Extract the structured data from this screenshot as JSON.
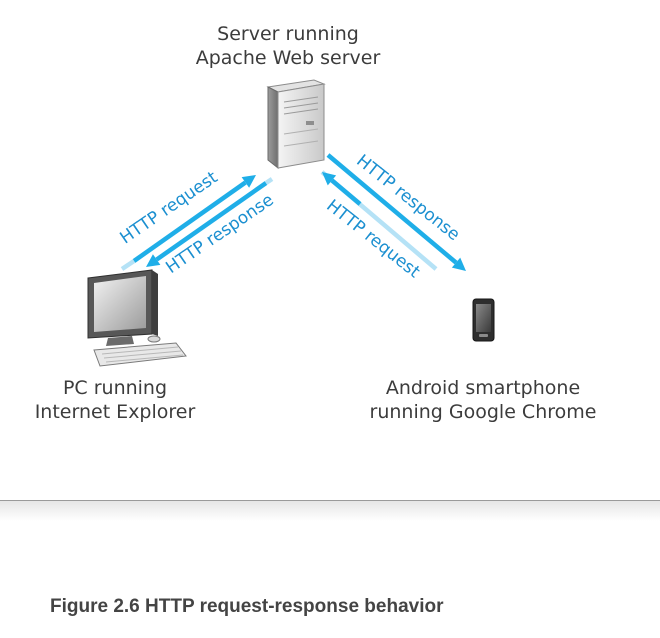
{
  "colors": {
    "arrow_dark": "#1faee8",
    "arrow_light": "#b5e2f6",
    "arrow_text": "#1b8fd0",
    "label_text": "#3c3c3c",
    "caption_text": "#444444"
  },
  "nodes": {
    "server": {
      "line1": "Server running",
      "line2": "Apache Web server",
      "icon": "server-tower-icon"
    },
    "pc": {
      "line1": "PC running",
      "line2": "Internet Explorer",
      "icon": "desktop-computer-icon"
    },
    "phone": {
      "line1": "Android smartphone",
      "line2": "running Google Chrome",
      "icon": "smartphone-icon"
    }
  },
  "arrows": {
    "pc_request": "HTTP request",
    "pc_response": "HTTP response",
    "phone_response": "HTTP response",
    "phone_request": "HTTP request"
  },
  "caption": "Figure 2.6 HTTP request-response behavior"
}
